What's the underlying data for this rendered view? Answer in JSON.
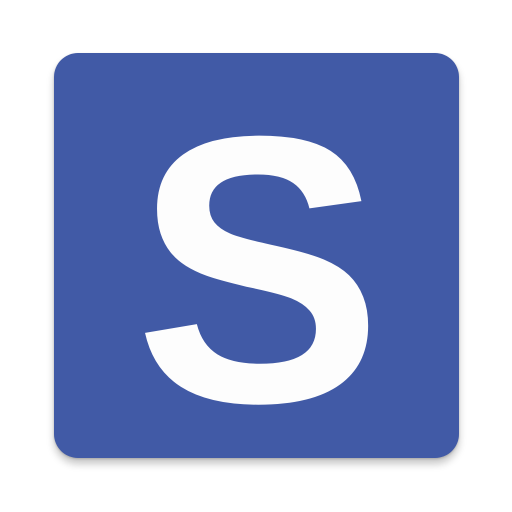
{
  "app_icon": {
    "letter": "S",
    "background_color": "#415aa6",
    "letter_color": "#fdfdfd"
  }
}
